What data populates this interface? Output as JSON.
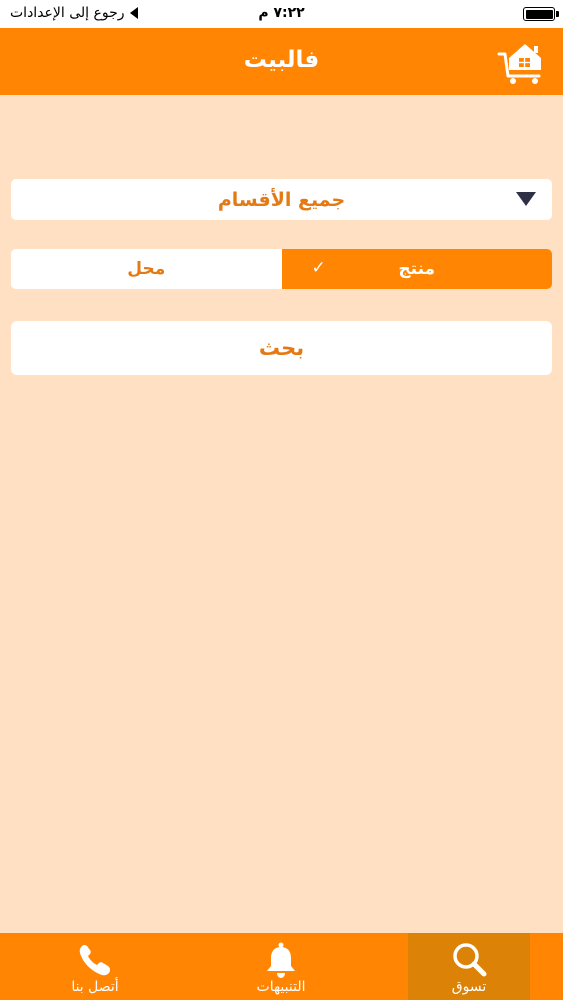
{
  "status_bar": {
    "back_label": "رجوع إلى الإعدادات",
    "time": "٧:٢٢ م"
  },
  "header": {
    "title": "فالبيت",
    "icon": "cart-home-icon"
  },
  "category_dropdown": {
    "selected": "جميع الأقسام",
    "icon": "dropdown-arrow-icon"
  },
  "search_type": {
    "options": [
      "منتج",
      "محل"
    ],
    "selected": "منتج",
    "check_icon": "✓"
  },
  "search_button": {
    "label": "بحث"
  },
  "tab_bar": {
    "items": [
      {
        "label": "تسوق",
        "icon": "search-icon",
        "active": true
      },
      {
        "label": "التنبيهات",
        "icon": "bell-icon",
        "active": false
      },
      {
        "label": "أتصل بنا",
        "icon": "phone-icon",
        "active": false
      }
    ]
  },
  "colors": {
    "primary": "#ff8503",
    "background": "#ffe0c2",
    "accent_text": "#e37a13",
    "active_tab": "#db8207",
    "arrow": "#2e3046"
  }
}
